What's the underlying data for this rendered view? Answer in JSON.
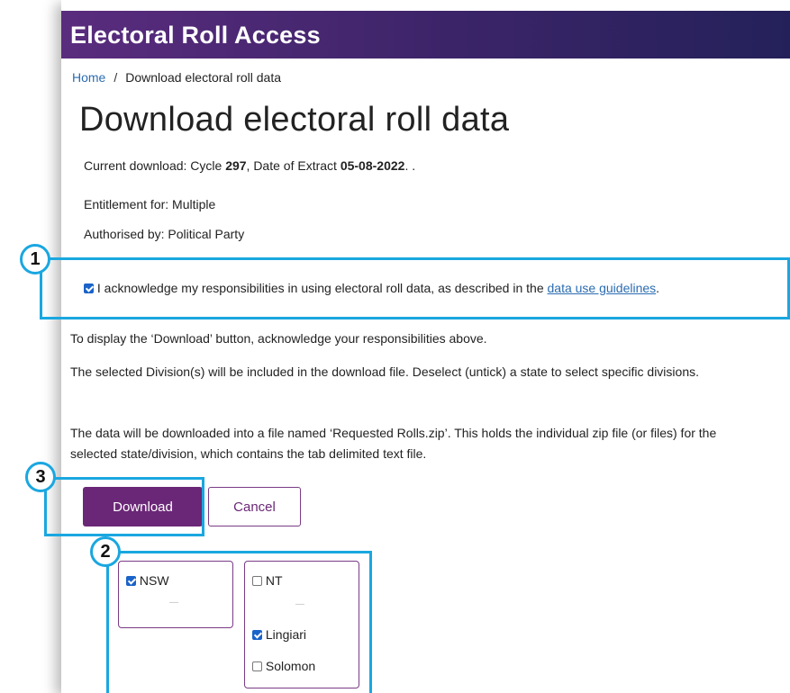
{
  "header": {
    "title": "Electoral Roll Access"
  },
  "breadcrumb": {
    "home": "Home",
    "separator": "/",
    "current": "Download electoral roll data"
  },
  "page": {
    "title": "Download electoral roll data",
    "current_prefix": "Current download: Cycle ",
    "cycle": "297",
    "date_prefix": ", Date of Extract ",
    "date": "05-08-2022",
    "current_suffix": ". .",
    "entitlement": "Entitlement for: Multiple",
    "authorised": "Authorised by: Political Party"
  },
  "acknowledge": {
    "checked": true,
    "text": "I acknowledge my responsibilities in using electoral roll data, as described in the ",
    "link": "data use guidelines",
    "end": "."
  },
  "info": {
    "p1": "To display the ‘Download’ button, acknowledge your responsibilities above.",
    "p2": "The selected Division(s) will be included in the download file. Deselect (untick) a state to select specific divisions.",
    "p3": "The data will be downloaded into a file named ‘Requested Rolls.zip’. This holds the individual zip file (or files) for the selected state/division, which contains the tab delimited text file."
  },
  "buttons": {
    "download": "Download",
    "cancel": "Cancel"
  },
  "states": {
    "nsw": {
      "label": "NSW",
      "checked": true,
      "dash": "—"
    },
    "nt": {
      "label": "NT",
      "checked": false,
      "dash": "—",
      "divisions": [
        {
          "label": "Lingiari",
          "checked": true
        },
        {
          "label": "Solomon",
          "checked": false
        }
      ]
    }
  },
  "callouts": {
    "one": "1",
    "two": "2",
    "three": "3"
  },
  "colors": {
    "header": "#3b2468",
    "primary": "#6b2777",
    "callout": "#1aa7e0",
    "link": "#2b6cb0"
  }
}
